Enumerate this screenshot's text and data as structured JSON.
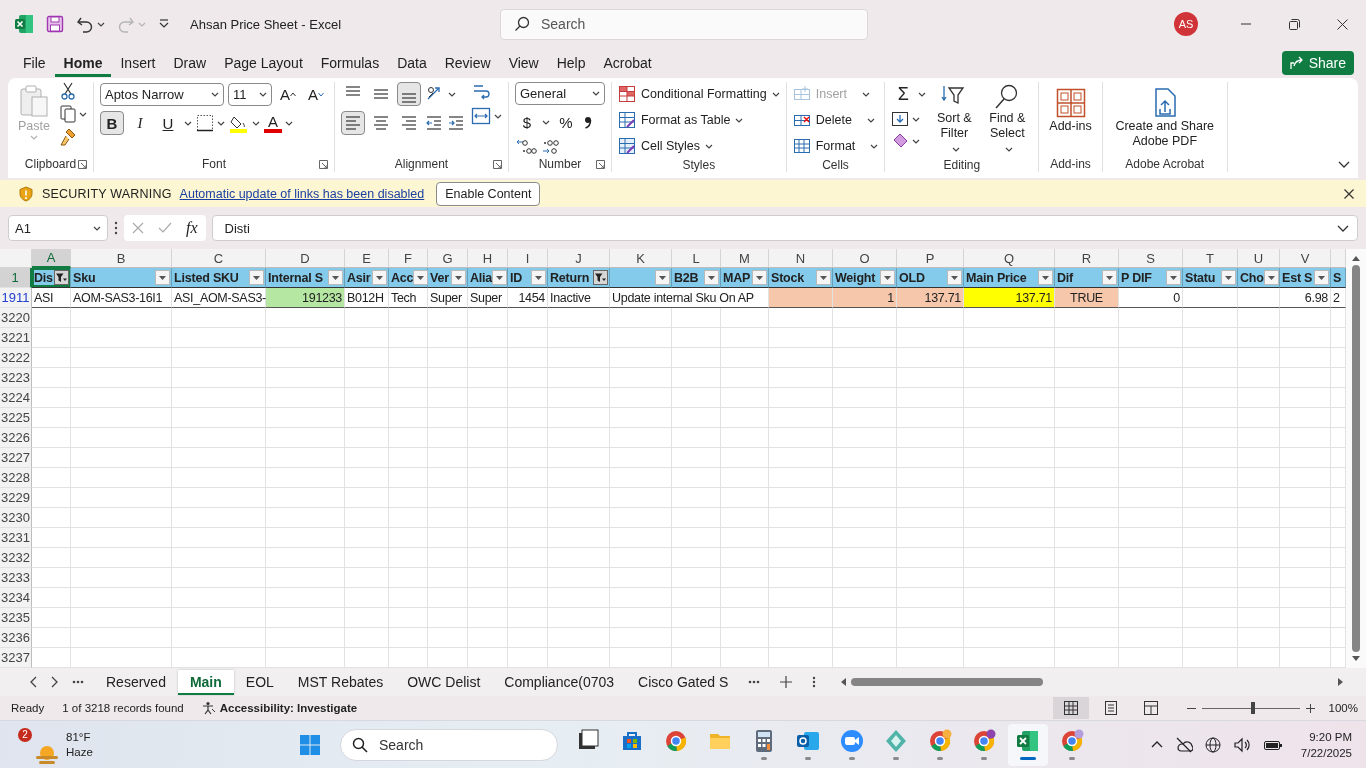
{
  "window": {
    "title": "Ahsan Price Sheet  -  Excel",
    "search": {
      "placeholder": "Search"
    },
    "account": {
      "initials": "AS"
    },
    "redo_disabled": true
  },
  "menu_tabs": [
    {
      "label": "File",
      "selected": false
    },
    {
      "label": "Home",
      "selected": true
    },
    {
      "label": "Insert",
      "selected": false
    },
    {
      "label": "Draw",
      "selected": false
    },
    {
      "label": "Page Layout",
      "selected": false
    },
    {
      "label": "Formulas",
      "selected": false
    },
    {
      "label": "Data",
      "selected": false
    },
    {
      "label": "Review",
      "selected": false
    },
    {
      "label": "View",
      "selected": false
    },
    {
      "label": "Help",
      "selected": false
    },
    {
      "label": "Acrobat",
      "selected": false
    }
  ],
  "share_button": "Share",
  "ribbon": {
    "groups": [
      {
        "kind": "clipboard",
        "label": "Clipboard",
        "launcher": true,
        "paste": {
          "label": "Paste",
          "disabled": true
        }
      },
      {
        "kind": "font",
        "label": "Font",
        "launcher": true,
        "font_name": "Aptos Narrow",
        "size_box": "11",
        "size_buttons": [
          "A",
          "A"
        ],
        "style_buttons": [
          {
            "label": "B",
            "selected": true
          },
          {
            "label": "I",
            "selected": false
          },
          {
            "label": "U",
            "selected": false
          }
        ],
        "font_color": "A"
      },
      {
        "kind": "alignment",
        "label": "Alignment",
        "launcher": true,
        "vertical": [
          {
            "selected": false
          },
          {
            "selected": false
          },
          {
            "selected": true
          }
        ],
        "horizontal": [
          {
            "selected": true
          },
          {
            "selected": false
          },
          {
            "selected": false
          }
        ]
      },
      {
        "kind": "number",
        "label": "Number",
        "launcher": true,
        "format": "General",
        "symbols": [
          "$",
          "%"
        ]
      },
      {
        "kind": "styles",
        "label": "Styles",
        "launcher": false,
        "buttons": [
          "Conditional Formatting",
          "Format as Table",
          "Cell Styles"
        ]
      },
      {
        "kind": "cells",
        "label": "Cells",
        "launcher": false,
        "buttons": [
          {
            "label": "Insert",
            "disabled": true
          },
          {
            "label": "Delete",
            "disabled": false
          },
          {
            "label": "Format",
            "disabled": false
          }
        ]
      },
      {
        "kind": "editing",
        "label": "Editing",
        "launcher": false,
        "sum": "Σ",
        "buttons": [
          "Sort & Filter",
          "Find & Select"
        ]
      },
      {
        "kind": "addins",
        "label": "Add-ins",
        "launcher": false,
        "button": "Add-ins"
      },
      {
        "kind": "acrobat",
        "label": "Adobe Acrobat",
        "launcher": false,
        "button": "Create and Share Adobe PDF"
      }
    ]
  },
  "security_bar": {
    "title": "SECURITY WARNING",
    "message": "Automatic update of links has been disabled",
    "button": "Enable Content"
  },
  "formula_bar": {
    "name_box": "A1",
    "function_label": "fx",
    "content": "Disti"
  },
  "sheet": {
    "columns": [
      {
        "letter": "A",
        "selected": true
      },
      {
        "letter": "B",
        "selected": false
      },
      {
        "letter": "C",
        "selected": false
      },
      {
        "letter": "D",
        "selected": false
      },
      {
        "letter": "E",
        "selected": false
      },
      {
        "letter": "F",
        "selected": false
      },
      {
        "letter": "G",
        "selected": false
      },
      {
        "letter": "H",
        "selected": false
      },
      {
        "letter": "I",
        "selected": false
      },
      {
        "letter": "J",
        "selected": false
      },
      {
        "letter": "K",
        "selected": false
      },
      {
        "letter": "L",
        "selected": false
      },
      {
        "letter": "M",
        "selected": false
      },
      {
        "letter": "N",
        "selected": false
      },
      {
        "letter": "O",
        "selected": false
      },
      {
        "letter": "P",
        "selected": false
      },
      {
        "letter": "Q",
        "selected": false
      },
      {
        "letter": "R",
        "selected": false
      },
      {
        "letter": "S",
        "selected": false
      },
      {
        "letter": "T",
        "selected": false
      },
      {
        "letter": "U",
        "selected": false
      },
      {
        "letter": "V",
        "selected": false
      },
      {
        "selected": false
      }
    ],
    "rows": [
      {
        "number": "1",
        "selected": true,
        "filtered": false,
        "kind": "header",
        "cells": [
          {
            "text": "Dis",
            "filter": true,
            "filtered": true
          },
          {
            "text": "Sku",
            "filter": true,
            "filtered": false
          },
          {
            "text": "Listed SKU",
            "filter": true,
            "filtered": false
          },
          {
            "text": "Internal S",
            "filter": true,
            "filtered": false
          },
          {
            "text": "Asir",
            "filter": true,
            "filtered": false
          },
          {
            "text": "Acc",
            "filter": true,
            "filtered": false
          },
          {
            "text": "Ver",
            "filter": true,
            "filtered": false
          },
          {
            "text": "Alia",
            "filter": true,
            "filtered": false
          },
          {
            "text": "ID",
            "filter": true,
            "filtered": false
          },
          {
            "text": "Return",
            "filter": true,
            "filtered": true
          },
          {
            "filter": true,
            "filtered": false
          },
          {
            "text": "B2B",
            "filter": true,
            "filtered": false
          },
          {
            "text": "MAP",
            "filter": true,
            "filtered": false
          },
          {
            "text": "Stock",
            "filter": true,
            "filtered": false
          },
          {
            "text": "Weight",
            "filter": true,
            "filtered": false
          },
          {
            "text": "OLD",
            "filter": true,
            "filtered": false
          },
          {
            "text": "Main Price",
            "filter": true,
            "filtered": false
          },
          {
            "text": "Dif",
            "filter": true,
            "filtered": false
          },
          {
            "text": "P DIF",
            "filter": true,
            "filtered": false
          },
          {
            "text": "Statu",
            "filter": true,
            "filtered": false
          },
          {
            "text": "Cho",
            "filter": true,
            "filtered": false
          },
          {
            "text": "Est S",
            "filter": true,
            "filtered": false
          },
          {
            "text": "S",
            "filter": false
          }
        ]
      },
      {
        "number": "1911",
        "selected": false,
        "filtered": true,
        "kind": "data",
        "cells": [
          {
            "text": "ASI"
          },
          {
            "text": "AOM-SAS3-16I1"
          },
          {
            "text": "ASI_AOM-SAS3-"
          },
          {
            "text": "191233",
            "kind": "number",
            "color": "#b5e6a2"
          },
          {
            "text": "B012H"
          },
          {
            "text": "Tech"
          },
          {
            "text": "Super"
          },
          {
            "text": "Super"
          },
          {
            "text": "1454",
            "kind": "number"
          },
          {
            "text": "Inactive"
          },
          {
            "text": "Update internal Sku On AP"
          },
          {},
          {},
          {
            "color": "#f7c7ac"
          },
          {
            "text": "1",
            "kind": "number",
            "color": "#f7c7ac"
          },
          {
            "text": "137.71",
            "kind": "number",
            "color": "#f7c7ac"
          },
          {
            "text": "137.71",
            "kind": "number",
            "color": "#ffff00"
          },
          {
            "text": "TRUE",
            "kind": "boolean",
            "color": "#f7c7ac"
          },
          {
            "text": "0",
            "kind": "number"
          },
          {},
          {},
          {
            "text": "6.98",
            "kind": "number"
          },
          {
            "text": "2"
          }
        ]
      },
      {
        "number": "3220",
        "selected": false,
        "filtered": false,
        "kind": "blank"
      },
      {
        "number": "3221",
        "selected": false,
        "filtered": false,
        "kind": "blank"
      },
      {
        "number": "3222",
        "selected": false,
        "filtered": false,
        "kind": "blank"
      },
      {
        "number": "3223",
        "selected": false,
        "filtered": false,
        "kind": "blank"
      },
      {
        "number": "3224",
        "selected": false,
        "filtered": false,
        "kind": "blank"
      },
      {
        "number": "3225",
        "selected": false,
        "filtered": false,
        "kind": "blank"
      },
      {
        "number": "3226",
        "selected": false,
        "filtered": false,
        "kind": "blank"
      },
      {
        "number": "3227",
        "selected": false,
        "filtered": false,
        "kind": "blank"
      },
      {
        "number": "3228",
        "selected": false,
        "filtered": false,
        "kind": "blank"
      },
      {
        "number": "3229",
        "selected": false,
        "filtered": false,
        "kind": "blank"
      },
      {
        "number": "3230",
        "selected": false,
        "filtered": false,
        "kind": "blank"
      },
      {
        "number": "3231",
        "selected": false,
        "filtered": false,
        "kind": "blank"
      },
      {
        "number": "3232",
        "selected": false,
        "filtered": false,
        "kind": "blank"
      },
      {
        "number": "3233",
        "selected": false,
        "filtered": false,
        "kind": "blank"
      },
      {
        "number": "3234",
        "selected": false,
        "filtered": false,
        "kind": "blank"
      },
      {
        "number": "3235",
        "selected": false,
        "filtered": false,
        "kind": "blank"
      },
      {
        "number": "3236",
        "selected": false,
        "filtered": false,
        "kind": "blank"
      },
      {
        "number": "3237",
        "selected": false,
        "filtered": false,
        "kind": "blank"
      }
    ]
  },
  "sheet_tabs": [
    {
      "label": "Reserved",
      "selected": false
    },
    {
      "label": "Main",
      "selected": true
    },
    {
      "label": "EOL",
      "selected": false
    },
    {
      "label": "MST Rebates",
      "selected": false
    },
    {
      "label": "OWC Delist",
      "selected": false
    },
    {
      "label": "Compliance(0703",
      "selected": false
    },
    {
      "label": "Cisco Gated S",
      "selected": false
    }
  ],
  "status_bar": {
    "mode": "Ready",
    "records": "1 of 3218 records found",
    "accessibility": "Accessibility: Investigate",
    "views": [
      {
        "selected": true
      },
      {
        "selected": false
      },
      {
        "selected": false
      }
    ],
    "zoom": {
      "level": 0.52
    },
    "zoom_label": "100%"
  },
  "taskbar": {
    "weather": {
      "badge": "2",
      "temperature": "81°F",
      "condition": "Haze"
    },
    "search": {
      "placeholder": "Search"
    },
    "apps": [
      {
        "running": false,
        "selected": false
      },
      {
        "running": false,
        "selected": false
      },
      {
        "running": false,
        "selected": false
      },
      {
        "running": false,
        "selected": false
      },
      {
        "running": true,
        "selected": false
      },
      {
        "running": true,
        "selected": false
      },
      {
        "running": true,
        "selected": false
      },
      {
        "running": true,
        "selected": false
      },
      {
        "running": true,
        "selected": false
      },
      {
        "running": true,
        "selected": false
      },
      {
        "running": true,
        "selected": true
      },
      {
        "running": true,
        "selected": false
      }
    ],
    "clock": {
      "time": "9:20 PM",
      "date": "7/22/2025"
    }
  }
}
